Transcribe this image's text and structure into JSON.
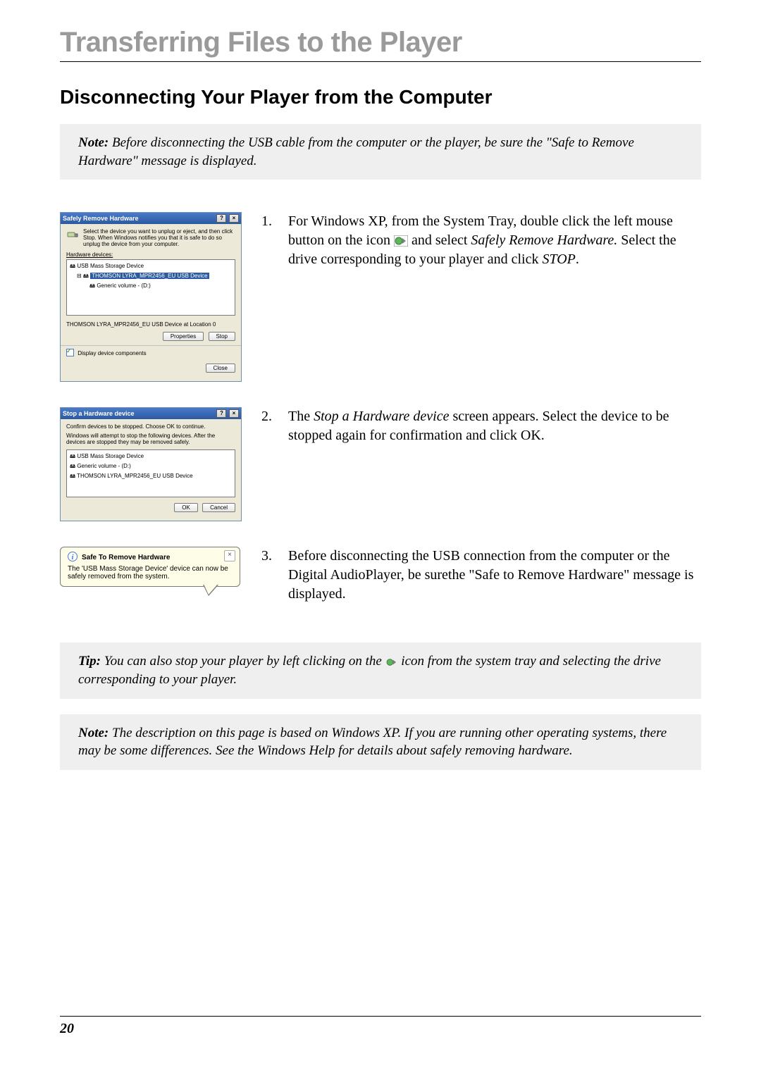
{
  "chapter_title": "Transferring Files to the Player",
  "section_title": "Disconnecting Your Player from the Computer",
  "intro_note": {
    "label": "Note:",
    "body": "Before disconnecting the USB cable from the computer or the player, be sure the \"Safe to Remove Hardware\" message is displayed."
  },
  "steps": {
    "step1": {
      "num": "1.",
      "text_a": "For Windows XP, from the System Tray, double click the left mouse button on the icon ",
      "text_b": " and select ",
      "em1": "Safely Remove Hardware.",
      "text_c": " Select the drive corresponding to your player and click ",
      "em2": "STOP",
      "text_d": "."
    },
    "step2": {
      "num": "2.",
      "text_a": "The ",
      "em1": "Stop a Hardware device",
      "text_b": " screen appears. Select the device to be stopped again for confirmation and click OK."
    },
    "step3": {
      "num": "3.",
      "text": "Before disconnecting the USB connection from the computer or the Digital AudioPlayer, be surethe \"Safe to Remove Hardware\" message is displayed."
    }
  },
  "dialog1": {
    "title": "Safely Remove Hardware",
    "help_glyph": "?",
    "close_glyph": "×",
    "info_text": "Select the device you want to unplug or eject, and then click Stop. When Windows notifies you that it is safe to do so unplug the device from your computer.",
    "hw_label": "Hardware devices:",
    "devices": {
      "d0": "USB Mass Storage Device",
      "d1_sel": "THOMSON LYRA_MPR2456_EU USB Device",
      "d2": "Generic volume - (D:)"
    },
    "location_text": "THOMSON LYRA_MPR2456_EU USB Device at Location 0",
    "btn_properties": "Properties",
    "btn_stop": "Stop",
    "chk_label": "Display device components",
    "btn_close": "Close"
  },
  "dialog2": {
    "title": "Stop a Hardware device",
    "help_glyph": "?",
    "close_glyph": "×",
    "line1": "Confirm devices to be stopped. Choose OK to continue.",
    "line2": "Windows will attempt to stop the following devices. After the devices are stopped they may be removed safely.",
    "devices": {
      "d0": "USB Mass Storage Device",
      "d1": "Generic volume - (D:)",
      "d2": "THOMSON LYRA_MPR2456_EU USB Device"
    },
    "btn_ok": "OK",
    "btn_cancel": "Cancel"
  },
  "balloon": {
    "title": "Safe To Remove Hardware",
    "close_glyph": "×",
    "body": "The 'USB Mass Storage Device' device can now be safely removed from the system."
  },
  "tip_box": {
    "label": "Tip:",
    "body_a": "You can also stop your player by left clicking on the ",
    "body_b": " icon from the system tray and selecting the drive corresponding to your player."
  },
  "note2": {
    "label": "Note:",
    "body": "The description on this page is based on Windows XP. If you are running other operating systems, there may be some differences. See the Windows Help for details about safely removing hardware."
  },
  "page_number": "20"
}
